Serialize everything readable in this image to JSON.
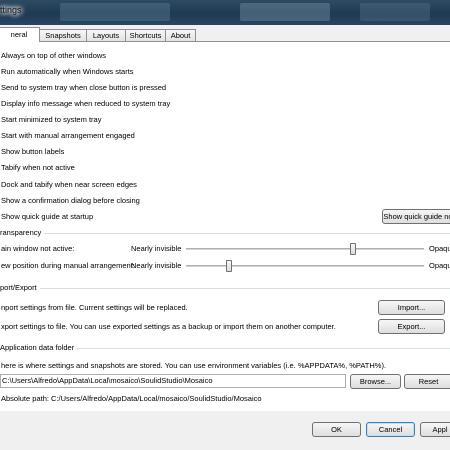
{
  "window": {
    "title": "ttings"
  },
  "tabs": [
    {
      "label": "neral",
      "active": true
    },
    {
      "label": "Snapshots",
      "active": false
    },
    {
      "label": "Layouts",
      "active": false
    },
    {
      "label": "Shortcuts",
      "active": false
    },
    {
      "label": "About",
      "active": false
    }
  ],
  "general_options": [
    "Always on top of other windows",
    "Run automatically when Windows starts",
    "Send to system tray when close button is pressed",
    "Display info message when reduced to system tray",
    "Start minimized to system tray",
    "Start with manual arrangement engaged",
    "Show button labels",
    "Tabify when not active",
    "Dock and tabify when near screen edges",
    "Show a confirmation dialog before closing",
    "Show quick guide at startup"
  ],
  "quick_guide_button": "Show quick guide no",
  "transparency": {
    "title": "ransparency",
    "rows": [
      {
        "label": "ain window not active:",
        "min_label": "Nearly invisible",
        "max_label": "Opaqu",
        "value": 0.7
      },
      {
        "label": "ew position during manual arrangement:",
        "min_label": "Nearly invisible",
        "max_label": "Opaqu",
        "value": 0.18
      }
    ]
  },
  "import_export": {
    "title": "port/Export",
    "import_text": "nport settings from file. Current settings will be replaced.",
    "import_button": "Import...",
    "export_text": "xport settings to file. You can use exported settings as a backup or import them on another computer.",
    "export_button": "Export..."
  },
  "app_data": {
    "title": "Application data folder",
    "description": "here is where settings and snapshots are stored. You can use environment variables (i.e. %APPDATA%, %PATH%).",
    "path_value": "C:\\Users\\Alfredo\\AppData\\Local\\mosaico\\SoulidStudio\\Mosaico",
    "browse_button": "Browse...",
    "reset_button": "Reset",
    "absolute_path": "Absolute path: C:/Users/Alfredo/AppData/Local/mosaico/SoulidStudio/Mosaico"
  },
  "footer": {
    "ok": "OK",
    "cancel": "Cancel",
    "apply": "Appl"
  }
}
